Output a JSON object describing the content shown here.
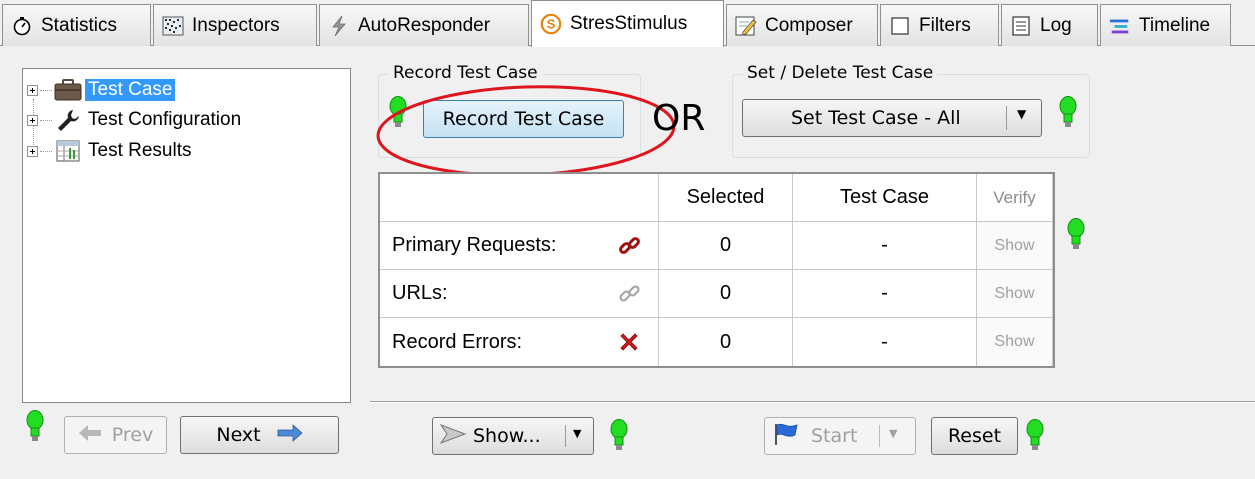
{
  "tabs": [
    {
      "label": "Statistics",
      "icon": "stopwatch-icon"
    },
    {
      "label": "Inspectors",
      "icon": "inspectors-icon"
    },
    {
      "label": "AutoResponder",
      "icon": "lightning-icon"
    },
    {
      "label": "StresStimulus",
      "icon": "stresstimulus-icon",
      "active": true
    },
    {
      "label": "Composer",
      "icon": "pencil-icon"
    },
    {
      "label": "Filters",
      "icon": "checkbox-icon"
    },
    {
      "label": "Log",
      "icon": "log-icon"
    },
    {
      "label": "Timeline",
      "icon": "timeline-icon"
    }
  ],
  "tree": {
    "items": [
      {
        "label": "Test Case",
        "icon": "briefcase-icon",
        "selected": true
      },
      {
        "label": "Test Configuration",
        "icon": "wrench-icon"
      },
      {
        "label": "Test Results",
        "icon": "results-table-icon"
      }
    ]
  },
  "record_group": {
    "title": "Record Test Case",
    "button_label": "Record Test Case"
  },
  "or_label": "OR",
  "set_group": {
    "title": "Set / Delete Test Case",
    "dropdown_label": "Set Test Case - All"
  },
  "table": {
    "headers": {
      "selected": "Selected",
      "test_case": "Test Case",
      "verify": "Verify"
    },
    "rows": [
      {
        "label": "Primary Requests:",
        "icon": "chain-link-icon",
        "selected": "0",
        "test_case": "-",
        "verify": "Show"
      },
      {
        "label": "URLs:",
        "icon": "chain-link-gray-icon",
        "selected": "0",
        "test_case": "-",
        "verify": "Show"
      },
      {
        "label": "Record Errors:",
        "icon": "red-x-icon",
        "selected": "0",
        "test_case": "-",
        "verify": "Show"
      }
    ]
  },
  "nav": {
    "prev_label": "Prev",
    "next_label": "Next"
  },
  "bottom": {
    "show_label": "Show...",
    "start_label": "Start",
    "reset_label": "Reset"
  },
  "colors": {
    "selection": "#3399ff",
    "bulb_green": "#22dd22",
    "highlight_ellipse": "#e0141e"
  }
}
